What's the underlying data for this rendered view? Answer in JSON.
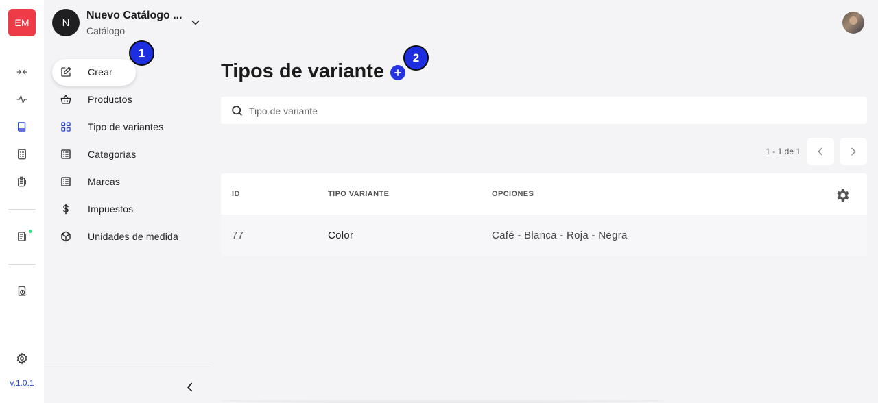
{
  "rail": {
    "logo": "EM",
    "version": "v.1.0.1",
    "icons": [
      "transfer-icon",
      "activity-icon",
      "book-icon",
      "checklist-icon",
      "clipboard-icon",
      "news-icon",
      "money-shield-icon",
      "gear-icon"
    ]
  },
  "catalog": {
    "avatar_letter": "N",
    "name": "Nuevo Catálogo ...",
    "type": "Catálogo"
  },
  "nav": {
    "create_label": "Crear",
    "items": [
      {
        "label": "Productos",
        "icon": "basket-icon"
      },
      {
        "label": "Tipo de variantes",
        "icon": "grid-icon"
      },
      {
        "label": "Categorías",
        "icon": "list-icon"
      },
      {
        "label": "Marcas",
        "icon": "list-icon"
      },
      {
        "label": "Impuestos",
        "icon": "dollar-icon"
      },
      {
        "label": "Unidades de medida",
        "icon": "box-icon"
      }
    ]
  },
  "annotations": {
    "step1": "1",
    "step2": "2"
  },
  "main": {
    "title": "Tipos de variante",
    "search_placeholder": "Tipo de variante",
    "pagination": "1 - 1 de 1",
    "table": {
      "headers": [
        "ID",
        "TIPO VARIANTE",
        "OPCIONES"
      ],
      "rows": [
        {
          "id": "77",
          "type": "Color",
          "options": "Café - Blanca - Roja - Negra"
        }
      ]
    }
  },
  "colors": {
    "accent": "#2433e4",
    "brand": "#ef3b47",
    "active_nav": "#2b46d6"
  }
}
